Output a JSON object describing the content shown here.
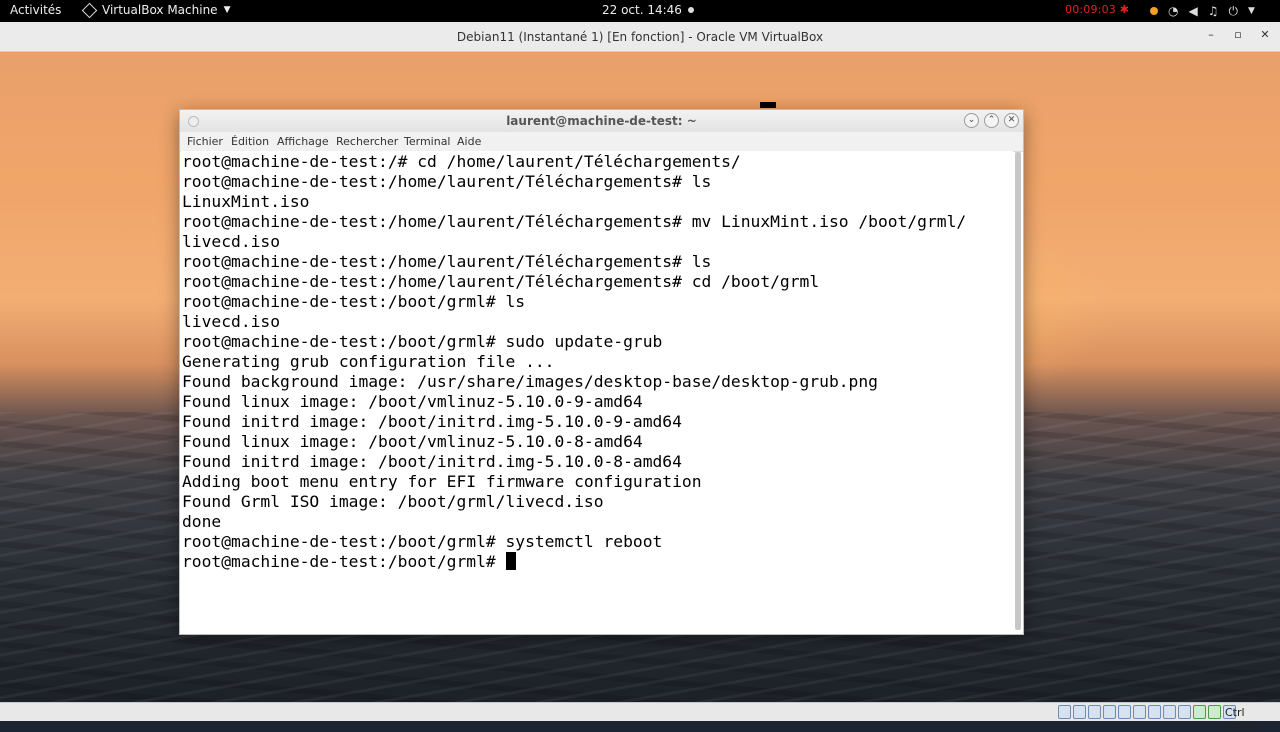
{
  "topbar": {
    "activities": "Activités",
    "app_menu": "VirtualBox Machine",
    "clock": "22 oct.  14:46",
    "recording_time": "00:09:03",
    "tray_icons": [
      "network-icon",
      "volume-icon",
      "microphone-icon",
      "power-icon"
    ]
  },
  "vbox_window": {
    "title": "Debian11 (Instantané 1) [En fonction] - Oracle VM VirtualBox",
    "host_key": "Ctrl droite"
  },
  "terminal": {
    "title": "laurent@machine-de-test: ~",
    "menu": [
      "Fichier",
      "Édition",
      "Affichage",
      "Rechercher",
      "Terminal",
      "Aide"
    ],
    "lines": [
      "root@machine-de-test:/# cd /home/laurent/Téléchargements/",
      "root@machine-de-test:/home/laurent/Téléchargements# ls",
      "LinuxMint.iso",
      "root@machine-de-test:/home/laurent/Téléchargements# mv LinuxMint.iso /boot/grml/",
      "livecd.iso",
      "root@machine-de-test:/home/laurent/Téléchargements# ls",
      "root@machine-de-test:/home/laurent/Téléchargements# cd /boot/grml",
      "root@machine-de-test:/boot/grml# ls",
      "livecd.iso",
      "root@machine-de-test:/boot/grml# sudo update-grub",
      "Generating grub configuration file ...",
      "Found background image: /usr/share/images/desktop-base/desktop-grub.png",
      "Found linux image: /boot/vmlinuz-5.10.0-9-amd64",
      "Found initrd image: /boot/initrd.img-5.10.0-9-amd64",
      "Found linux image: /boot/vmlinuz-5.10.0-8-amd64",
      "Found initrd image: /boot/initrd.img-5.10.0-8-amd64",
      "Adding boot menu entry for EFI firmware configuration",
      "Found Grml ISO image: /boot/grml/livecd.iso",
      "done",
      "root@machine-de-test:/boot/grml# systemctl reboot",
      "root@machine-de-test:/boot/grml# "
    ]
  },
  "colors": {
    "recording": "#e0241b",
    "terminal_bg": "#ffffff",
    "terminal_fg": "#000000"
  }
}
